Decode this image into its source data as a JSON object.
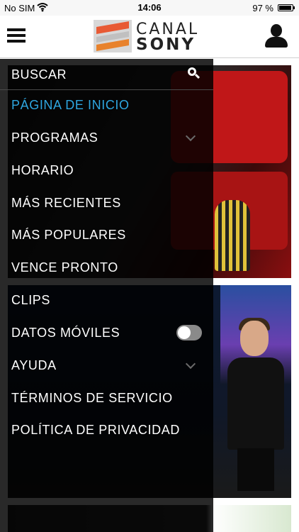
{
  "status_bar": {
    "carrier": "No SIM",
    "wifi_icon": "wifi-icon",
    "time": "14:06",
    "battery_text": "97 %",
    "battery_level": 0.97
  },
  "header": {
    "menu_icon": "hamburger-menu-icon",
    "logo_line1": "CANAL",
    "logo_line2": "SONY",
    "profile_icon": "user-profile-icon"
  },
  "drawer": {
    "search": {
      "label": "BUSCAR",
      "icon": "search-icon"
    },
    "items": [
      {
        "label": "PÁGINA DE INICIO",
        "active": true
      },
      {
        "label": "PROGRAMAS",
        "expandable": true
      },
      {
        "label": "HORARIO"
      },
      {
        "label": "MÁS RECIENTES"
      },
      {
        "label": "MÁS POPULARES"
      },
      {
        "label": "VENCE PRONTO"
      },
      {
        "label": "CLIPS"
      },
      {
        "label": "DATOS MÓVILES",
        "toggle": "off"
      },
      {
        "label": "AYUDA",
        "expandable": true
      },
      {
        "label": "TÉRMINOS DE SERVICIO"
      },
      {
        "label": "POLÍTICA DE PRIVACIDAD"
      }
    ]
  },
  "colors": {
    "active_item": "#2ea6e0",
    "drawer_bg": "#000000",
    "logo_orange": "#e85a34"
  }
}
